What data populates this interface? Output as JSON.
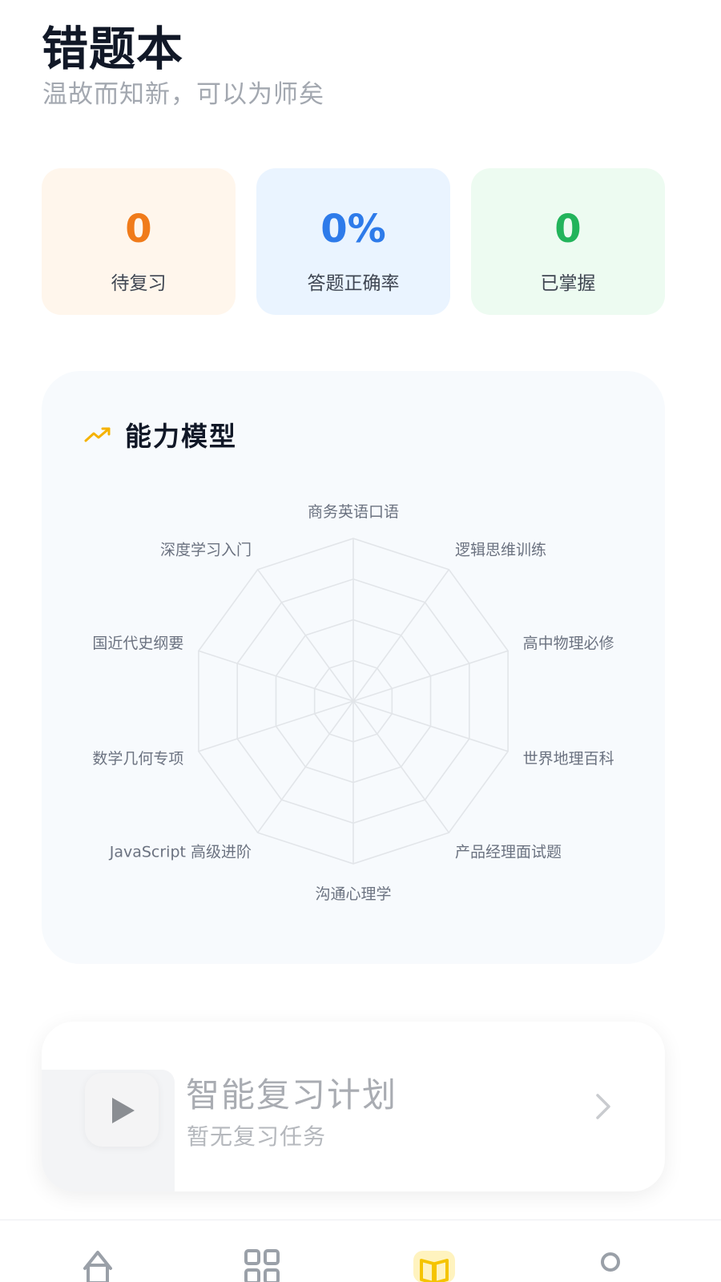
{
  "header": {
    "title": "错题本",
    "subtitle": "温故而知新，可以为师矣"
  },
  "stats": [
    {
      "value": "0",
      "label": "待复习",
      "color": "#f07b1a"
    },
    {
      "value": "0%",
      "label": "答题正确率",
      "color": "#2e7bea"
    },
    {
      "value": "0",
      "label": "已掌握",
      "color": "#22b45b"
    }
  ],
  "ability": {
    "title": "能力模型",
    "icon": "trending-up-icon",
    "icon_color": "#f5b200",
    "axes": [
      "商务英语口语",
      "逻辑思维训练",
      "高中物理必修",
      "世界地理百科",
      "产品经理面试题",
      "沟通心理学",
      "JavaScript 高级进阶",
      "数学几何专项",
      "国近代史纲要",
      "深度学习入门"
    ],
    "levels": 4
  },
  "plan": {
    "title": "智能复习计划",
    "subtitle": "暂无复习任务",
    "icon": "play-icon",
    "arrow_icon": "chevron-right-icon"
  },
  "tabbar": {
    "tabs": [
      {
        "icon": "home-icon"
      },
      {
        "icon": "grid-icon"
      },
      {
        "icon": "book-icon",
        "active": true,
        "active_color": "#f5c400"
      },
      {
        "icon": "user-icon"
      }
    ]
  }
}
